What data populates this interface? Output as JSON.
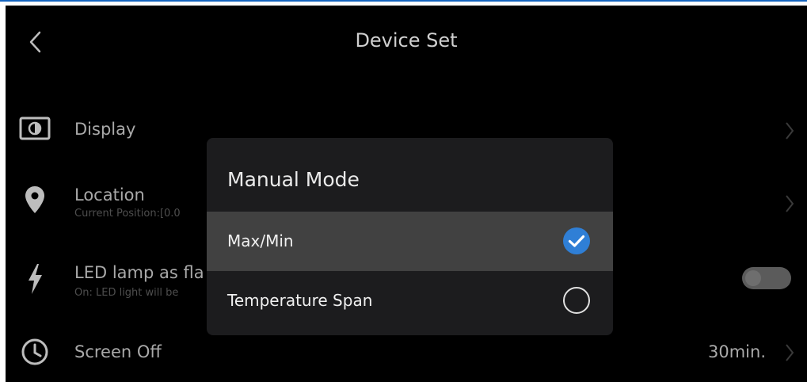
{
  "header": {
    "title": "Device Set"
  },
  "settings": {
    "display": {
      "label": "Display"
    },
    "location": {
      "label": "Location",
      "sub": "Current Position:[0.0"
    },
    "led": {
      "label": "LED lamp as fla",
      "sub": "On: LED light will be"
    },
    "screen_off": {
      "label": "Screen Off",
      "value": "30min."
    }
  },
  "dialog": {
    "title": "Manual Mode",
    "options": [
      {
        "label": "Max/Min",
        "selected": true
      },
      {
        "label": "Temperature Span",
        "selected": false
      }
    ]
  },
  "colors": {
    "accent": "#2f7fd6",
    "background": "#000000",
    "dialog": "#1c1c1e",
    "selected_row": "#414141"
  }
}
